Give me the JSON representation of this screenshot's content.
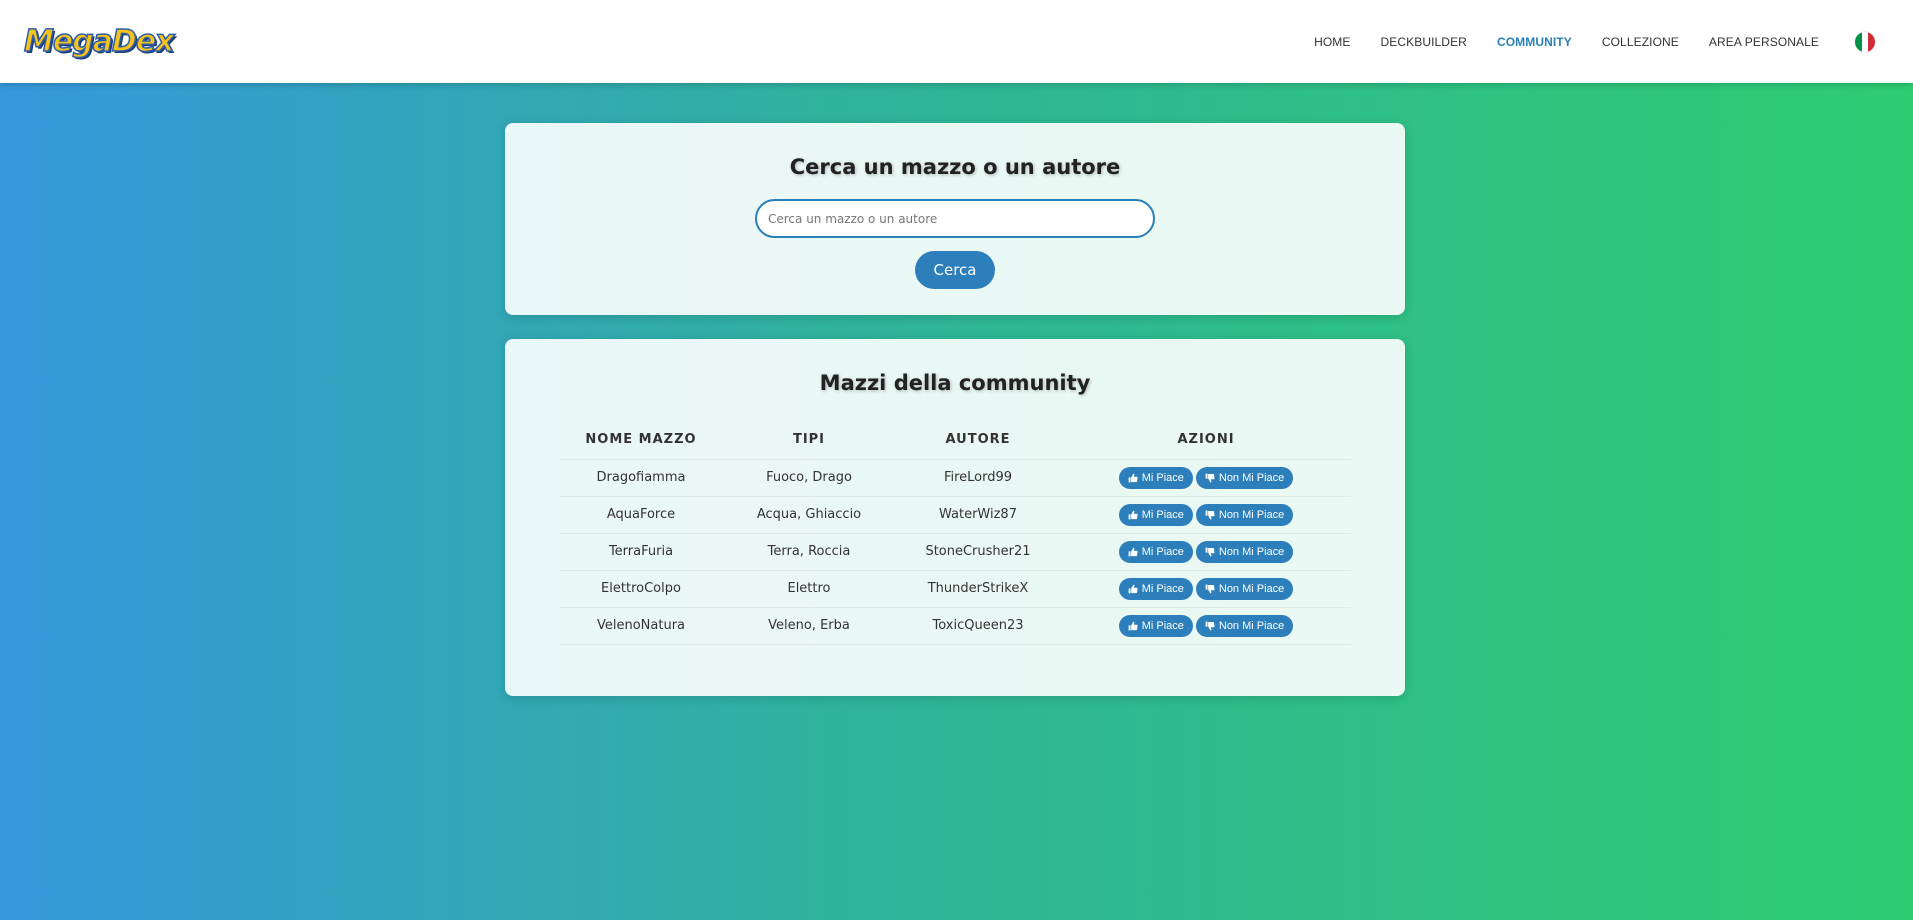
{
  "header": {
    "logo": "MegaDex",
    "nav": [
      {
        "label": "HOME",
        "name": "nav-home"
      },
      {
        "label": "DECKBUILDER",
        "name": "nav-deckbuilder"
      },
      {
        "label": "COMMUNITY",
        "name": "nav-community",
        "active": true
      },
      {
        "label": "COLLEZIONE",
        "name": "nav-collezione"
      },
      {
        "label": "AREA PERSONALE",
        "name": "nav-area-personale"
      }
    ],
    "language_flag": "it-flag-icon"
  },
  "search": {
    "title": "Cerca un mazzo o un autore",
    "placeholder": "Cerca un mazzo o un autore",
    "value": "",
    "button_label": "Cerca"
  },
  "community": {
    "title": "Mazzi della community",
    "columns": [
      "NOME MAZZO",
      "TIPI",
      "AUTORE",
      "AZIONI"
    ],
    "like_label": "Mi Piace",
    "dislike_label": "Non Mi Piace",
    "rows": [
      {
        "name": "Dragofiamma",
        "types": "Fuoco, Drago",
        "author": "FireLord99"
      },
      {
        "name": "AquaForce",
        "types": "Acqua, Ghiaccio",
        "author": "WaterWiz87"
      },
      {
        "name": "TerraFuria",
        "types": "Terra, Roccia",
        "author": "StoneCrusher21"
      },
      {
        "name": "ElettroColpo",
        "types": "Elettro",
        "author": "ThunderStrikeX"
      },
      {
        "name": "VelenoNatura",
        "types": "Veleno, Erba",
        "author": "ToxicQueen23"
      }
    ]
  },
  "colors": {
    "accent": "#2c7fbb",
    "nav_active": "#2980b9",
    "gradient_start": "#3598dc",
    "gradient_end": "#2ecc71"
  }
}
